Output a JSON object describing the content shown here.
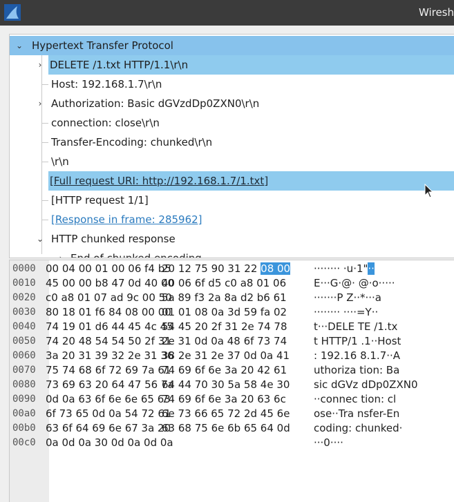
{
  "window": {
    "title": "Wiresh"
  },
  "detail": {
    "rows": [
      {
        "label": "Hypertext Transfer Protocol"
      },
      {
        "label": "DELETE /1.txt HTTP/1.1\\r\\n"
      },
      {
        "label": "Host: 192.168.1.7\\r\\n"
      },
      {
        "label": "Authorization: Basic dGVzdDp0ZXN0\\r\\n"
      },
      {
        "label": "connection: close\\r\\n"
      },
      {
        "label": "Transfer-Encoding: chunked\\r\\n"
      },
      {
        "label": "\\r\\n"
      },
      {
        "label": "[Full request URI: http://192.168.1.7/1.txt]"
      },
      {
        "label": "[HTTP request 1/1]"
      },
      {
        "label": "[Response in frame: 285962]"
      },
      {
        "label": "HTTP chunked response"
      },
      {
        "label": "End of chunked encoding"
      }
    ]
  },
  "hex": {
    "rows": [
      {
        "offset": "0000",
        "bytes1": "00 04 00 01 00 06 f4 b5",
        "bytes2": "20 12 75 90 31 22",
        "bytes2_hl": "08 00",
        "ascii": "········  ·u·1\"",
        "ascii_hl": "··"
      },
      {
        "offset": "0010",
        "bytes1": "45 00 00 b8 47 0d 40 00",
        "bytes2": "40 06 6f d5 c0 a8 01 06",
        "bytes2_hl": "",
        "ascii": "E···G·@· @·o·····",
        "ascii_hl": ""
      },
      {
        "offset": "0020",
        "bytes1": "c0 a8 01 07 ad 9c 00 50",
        "bytes2": "5a 89 f3 2a 8a d2 b6 61",
        "bytes2_hl": "",
        "ascii": "·······P Z··*···a",
        "ascii_hl": ""
      },
      {
        "offset": "0030",
        "bytes1": "80 18 01 f6 84 08 00 00",
        "bytes2": "01 01 08 0a 3d 59 fa 02",
        "bytes2_hl": "",
        "ascii": "········ ····=Y··",
        "ascii_hl": ""
      },
      {
        "offset": "0040",
        "bytes1": "74 19 01 d6 44 45 4c 45",
        "bytes2": "54 45 20 2f 31 2e 74 78",
        "bytes2_hl": "",
        "ascii": "t···DELE TE /1.tx",
        "ascii_hl": ""
      },
      {
        "offset": "0050",
        "bytes1": "74 20 48 54 54 50 2f 31",
        "bytes2": "2e 31 0d 0a 48 6f 73 74",
        "bytes2_hl": "",
        "ascii": "t HTTP/1 .1··Host",
        "ascii_hl": ""
      },
      {
        "offset": "0060",
        "bytes1": "3a 20 31 39 32 2e 31 36",
        "bytes2": "38 2e 31 2e 37 0d 0a 41",
        "bytes2_hl": "",
        "ascii": ": 192.16 8.1.7··A",
        "ascii_hl": ""
      },
      {
        "offset": "0070",
        "bytes1": "75 74 68 6f 72 69 7a 61",
        "bytes2": "74 69 6f 6e 3a 20 42 61",
        "bytes2_hl": "",
        "ascii": "uthoriza tion: Ba",
        "ascii_hl": ""
      },
      {
        "offset": "0080",
        "bytes1": "73 69 63 20 64 47 56 7a",
        "bytes2": "64 44 70 30 5a 58 4e 30",
        "bytes2_hl": "",
        "ascii": "sic dGVz dDp0ZXN0",
        "ascii_hl": ""
      },
      {
        "offset": "0090",
        "bytes1": "0d 0a 63 6f 6e 6e 65 63",
        "bytes2": "74 69 6f 6e 3a 20 63 6c",
        "bytes2_hl": "",
        "ascii": "··connec tion: cl",
        "ascii_hl": ""
      },
      {
        "offset": "00a0",
        "bytes1": "6f 73 65 0d 0a 54 72 61",
        "bytes2": "6e 73 66 65 72 2d 45 6e",
        "bytes2_hl": "",
        "ascii": "ose··Tra nsfer-En",
        "ascii_hl": ""
      },
      {
        "offset": "00b0",
        "bytes1": "63 6f 64 69 6e 67 3a 20",
        "bytes2": "63 68 75 6e 6b 65 64 0d",
        "bytes2_hl": "",
        "ascii": "coding:  chunked·",
        "ascii_hl": ""
      },
      {
        "offset": "00c0",
        "bytes1": "0a 0d 0a 30 0d 0a 0d 0a",
        "bytes2": "",
        "bytes2_hl": "",
        "ascii": "···0····",
        "ascii_hl": ""
      }
    ]
  },
  "colors": {
    "selection": "#87c2ec",
    "hex_highlight": "#3b95dc",
    "link": "#2b7bbf"
  }
}
